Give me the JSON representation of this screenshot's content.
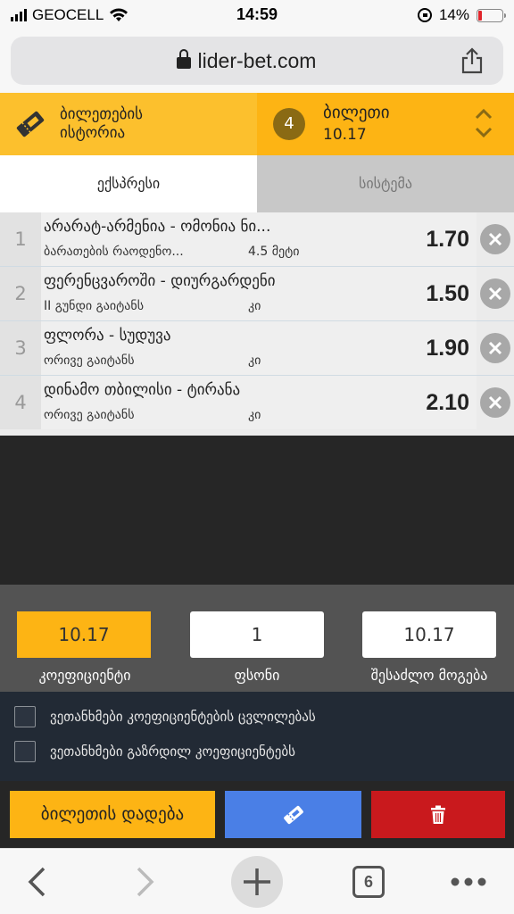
{
  "status": {
    "carrier": "GEOCELL",
    "time": "14:59",
    "battery": "14%"
  },
  "browser": {
    "url": "lider-bet.com",
    "tabs_count": "6"
  },
  "header": {
    "history_label_1": "ბილეთების",
    "history_label_2": "ისტორია",
    "ticket_count": "4",
    "ticket_title": "ბილეთი",
    "ticket_total": "10.17"
  },
  "tabs": {
    "express": "ექსპრესი",
    "system": "სისტემა"
  },
  "bets": [
    {
      "n": "1",
      "match": "არარატ-არმენია - ომონია ნი...",
      "market": "ბარათების რაოდენო...",
      "outcome": "4.5 მეტი",
      "odd": "1.70"
    },
    {
      "n": "2",
      "match": "ფერენცვაროში - დიურგარდენი",
      "market": "II გუნდი გაიტანს",
      "outcome": "კი",
      "odd": "1.50"
    },
    {
      "n": "3",
      "match": "ფლორა - სუდუვა",
      "market": "ორივე გაიტანს",
      "outcome": "კი",
      "odd": "1.90"
    },
    {
      "n": "4",
      "match": "დინამო თბილისი - ტირანა",
      "market": "ორივე გაიტანს",
      "outcome": "კი",
      "odd": "2.10"
    }
  ],
  "summary": {
    "coef_value": "10.17",
    "coef_label": "კოეფიციენტი",
    "stake_value": "1",
    "stake_label": "ფსონი",
    "win_value": "10.17",
    "win_label": "შესაძლო მოგება"
  },
  "agree": {
    "odds_change": "ვეთანხმები კოეფიციენტების ცვლილებას",
    "boosted_odds": "ვეთანხმები გაზრდილ კოეფიციენტებს"
  },
  "actions": {
    "place_bet": "ბილეთის დადება"
  },
  "colors": {
    "accent": "#fdb414",
    "edit": "#4a7fe6",
    "delete": "#c9191d"
  }
}
